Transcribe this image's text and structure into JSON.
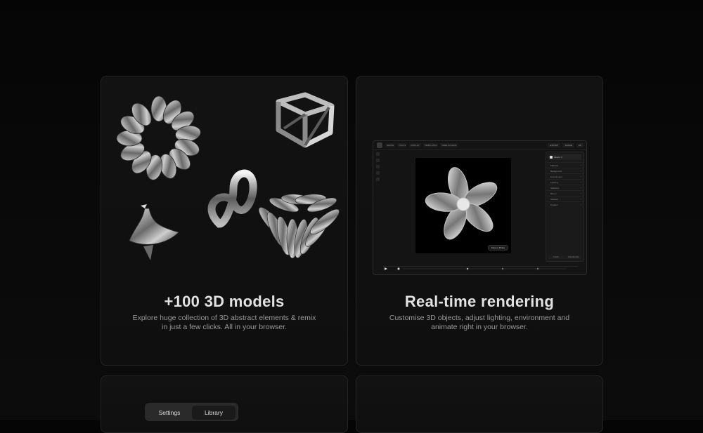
{
  "cards": [
    {
      "title": "+100 3D models",
      "description": "Explore huge collection of 3D abstract elements & remix in just a few clicks. All in your browser."
    },
    {
      "title": "Real-time rendering",
      "description": "Customise 3D objects, adjust lighting, environment and animate right in your browser."
    }
  ],
  "editor": {
    "menu": [
      "SHAPE",
      "TOOLS",
      "DISPLAY",
      "TEMPLATES",
      "FREE ACCESS"
    ],
    "top_right": [
      "EXPORT",
      "SHARE",
      "UP"
    ],
    "panel_title": "Flower 3",
    "panel_rows": [
      "Material",
      "Background",
      "Environment",
      "Lighting",
      "Shadows",
      "Bloom",
      "Shaders",
      "Position"
    ],
    "panel_buttons": [
      "Undo",
      "Randomize"
    ],
    "canvas_button": "Save to library"
  },
  "tabs": [
    "Settings",
    "Library"
  ],
  "colors": {
    "background": "#080808",
    "card": "#111111",
    "card_border": "#232323",
    "title": "#e2e2e2",
    "description": "#9a9a9a"
  }
}
